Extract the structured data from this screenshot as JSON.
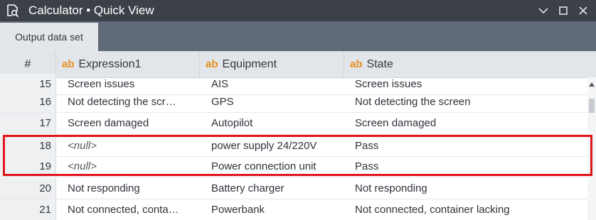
{
  "window": {
    "title": "Calculator • Quick View",
    "icon": "search-document-icon",
    "controls": [
      "chevron-down-icon",
      "maximize-icon",
      "close-icon"
    ]
  },
  "tabs": [
    {
      "label": "Output data set",
      "active": true
    }
  ],
  "columns": {
    "number": "#",
    "type_badge": "ab",
    "expression1": "Expression1",
    "equipment": "Equipment",
    "state": "State"
  },
  "rows": [
    {
      "num": "15",
      "expression1": "Screen issues",
      "equipment": "AIS",
      "state": "Screen issues"
    },
    {
      "num": "16",
      "expression1": "Not detecting the scr…",
      "equipment": "GPS",
      "state": "Not detecting the screen"
    },
    {
      "num": "17",
      "expression1": "Screen damaged",
      "equipment": "Autopilot",
      "state": "Screen damaged"
    },
    {
      "num": "18",
      "expression1": "<null>",
      "equipment": "power supply 24/220V",
      "state": "Pass"
    },
    {
      "num": "19",
      "expression1": "<null>",
      "equipment": "Power connection unit",
      "state": "Pass"
    },
    {
      "num": "20",
      "expression1": "Not responding",
      "equipment": "Battery charger",
      "state": "Not responding"
    },
    {
      "num": "21",
      "expression1": "Not connected, conta…",
      "equipment": "Powerbank",
      "state": "Not connected, container lacking"
    }
  ],
  "colors": {
    "titlebar": "#3c4048",
    "tabstrip": "#5f6977",
    "type_badge": "#e8901e",
    "highlight": "#e0151c"
  }
}
